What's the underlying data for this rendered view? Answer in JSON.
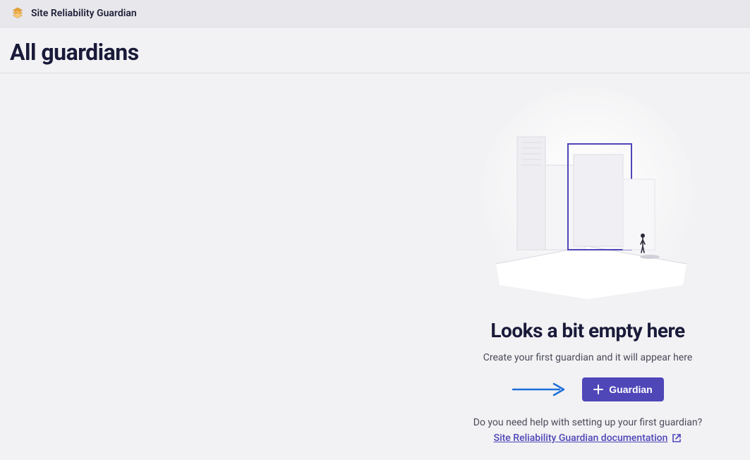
{
  "header": {
    "app_title": "Site Reliability Guardian"
  },
  "page": {
    "title": "All guardians"
  },
  "empty_state": {
    "title": "Looks a bit empty here",
    "subtitle": "Create your first guardian and it will appear here",
    "create_button_label": "Guardian",
    "help_text": "Do you need help with setting up your first guardian?",
    "doc_link_label": "Site Reliability Guardian documentation"
  }
}
